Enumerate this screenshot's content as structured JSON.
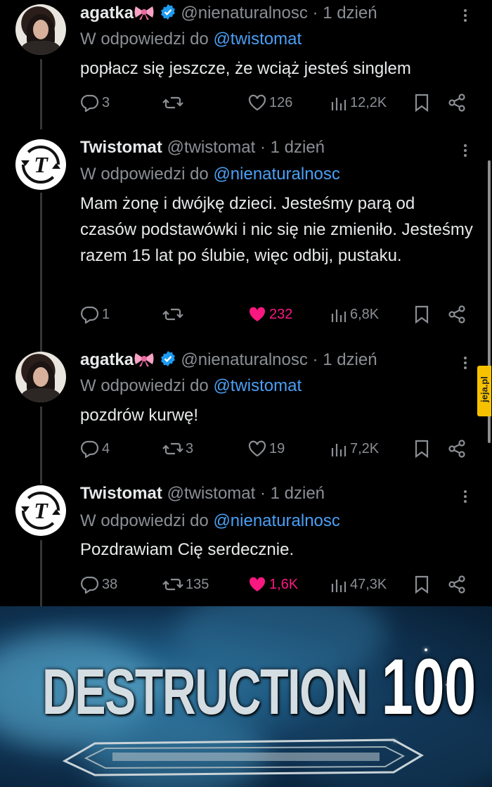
{
  "tweets": [
    {
      "name": "agatka",
      "handle": "@nienaturalnosc",
      "time": "· 1 dzień",
      "reply_prefix": "W odpowiedzi do",
      "reply_to": "@twistomat",
      "text": "popłacz się jeszcze, że wciąż jesteś singlem",
      "replies": "3",
      "retweets": "",
      "likes": "126",
      "views": "12,2K",
      "liked": false
    },
    {
      "name": "Twistomat",
      "handle": "@twistomat",
      "time": "· 1 dzień",
      "reply_prefix": "W odpowiedzi do",
      "reply_to": "@nienaturalnosc",
      "text": "Mam żonę i dwójkę dzieci. Jesteśmy parą od czasów podstawówki i nic się nie zmieniło. Jesteśmy razem 15 lat po ślubie, więc odbij, pustaku.",
      "replies": "1",
      "retweets": "",
      "likes": "232",
      "views": "6,8K",
      "liked": true
    },
    {
      "name": "agatka",
      "handle": "@nienaturalnosc",
      "time": "· 1 dzień",
      "reply_prefix": "W odpowiedzi do",
      "reply_to": "@twistomat",
      "text": "pozdrów kurwę!",
      "replies": "4",
      "retweets": "3",
      "likes": "19",
      "views": "7,2K",
      "liked": false
    },
    {
      "name": "Twistomat",
      "handle": "@twistomat",
      "time": "· 1 dzień",
      "reply_prefix": "W odpowiedzi do",
      "reply_to": "@nienaturalnosc",
      "text": "Pozdrawiam Cię serdecznie.",
      "replies": "38",
      "retweets": "135",
      "likes": "1,6K",
      "views": "47,3K",
      "liked": true
    }
  ],
  "meme": {
    "word": "DESTRUCTION",
    "number": "100"
  },
  "watermark": "jeja.pl",
  "colors": {
    "accent": "#4a9ff5",
    "like": "#f91880",
    "verified": "#1d9bf0",
    "muted": "#8b8f94"
  }
}
